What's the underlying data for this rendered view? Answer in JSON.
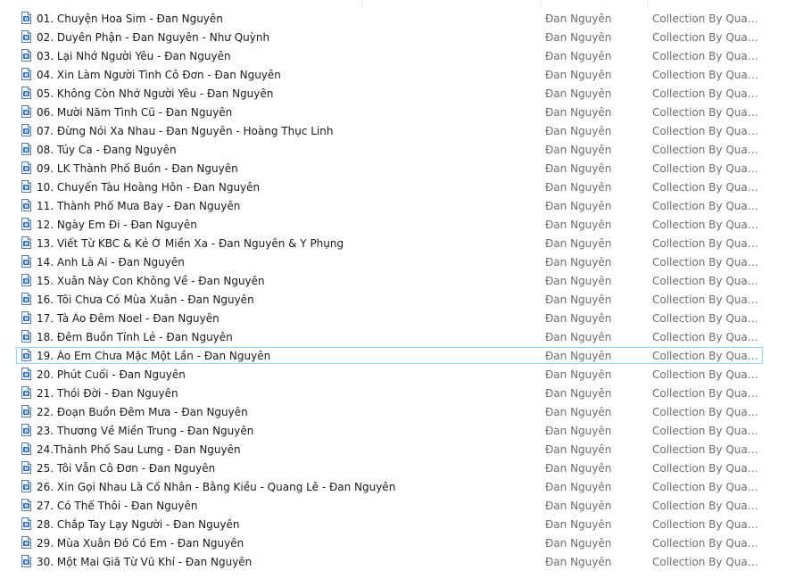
{
  "file_list": {
    "rows": [
      {
        "name": "01. Chuyện Hoa Sim - Đan Nguyên",
        "artist": "Đan Nguyên",
        "album": "Collection By Quang ..."
      },
      {
        "name": "02. Duyên Phận - Đan Nguyên - Như Quỳnh",
        "artist": "Đan Nguyên",
        "album": "Collection By Quang ..."
      },
      {
        "name": "03. Lại Nhớ Người Yêu - Đan Nguyên",
        "artist": "Đan Nguyên",
        "album": "Collection By Quang ..."
      },
      {
        "name": "04. Xin Làm Người Tình Cô Đơn - Đan Nguyên",
        "artist": "Đan Nguyên",
        "album": "Collection By Quang ..."
      },
      {
        "name": "05. Không Còn Nhớ Người Yêu - Đan Nguyên",
        "artist": "Đan Nguyên",
        "album": "Collection By Quang ..."
      },
      {
        "name": "06. Mười Năm Tình Cũ - Đan Nguyên",
        "artist": "Đan Nguyên",
        "album": "Collection By Quang ..."
      },
      {
        "name": "07. Đừng Nói Xa Nhau - Đan Nguyên - Hoàng Thục Linh",
        "artist": "Đan Nguyên",
        "album": "Collection By Quang ..."
      },
      {
        "name": "08. Túy Ca - Đang Nguyên",
        "artist": "Đan Nguyên",
        "album": "Collection By Quang ..."
      },
      {
        "name": "09. LK Thành Phố Buồn - Đan Nguyên",
        "artist": "Đan Nguyên",
        "album": "Collection By Quang ..."
      },
      {
        "name": "10. Chuyến Tàu Hoàng Hôn - Đan Nguyên",
        "artist": "Đan Nguyên",
        "album": "Collection By Quang ..."
      },
      {
        "name": "11. Thành Phố Mưa Bay - Đan Nguyên",
        "artist": "Đan Nguyên",
        "album": "Collection By Quang ..."
      },
      {
        "name": "12. Ngày Em Đi - Đan Nguyên",
        "artist": "Đan Nguyên",
        "album": "Collection By Quang ..."
      },
      {
        "name": "13. Viết Từ KBC &  Kẻ Ở Miền Xa - Đan Nguyên & Y Phụng",
        "artist": "Đan Nguyên",
        "album": "Collection By Quang ..."
      },
      {
        "name": "14. Anh Là Ai - Đan Nguyên",
        "artist": "Đan Nguyên",
        "album": "Collection By Quang ..."
      },
      {
        "name": "15. Xuân Này Con Không Về - Đan Nguyên",
        "artist": "Đan Nguyên",
        "album": "Collection By Quang ..."
      },
      {
        "name": "16. Tôi Chưa Có Mùa Xuân - Đan Nguyên",
        "artist": "Đan Nguyên",
        "album": "Collection By Quang ..."
      },
      {
        "name": "17. Tà Áo Đêm Noel - Đan Nguyên",
        "artist": "Đan Nguyên",
        "album": "Collection By Quang ..."
      },
      {
        "name": "18. Đêm Buồn Tỉnh Lẻ - Đan Nguyên",
        "artist": "Đan Nguyên",
        "album": "Collection By Quang ..."
      },
      {
        "name": "19. Áo Em Chưa Mặc Một Lần - Đan Nguyên",
        "artist": "Đan Nguyên",
        "album": "Collection By Quang ...",
        "selected": true
      },
      {
        "name": "20. Phút Cuối - Đan Nguyên",
        "artist": "Đan Nguyên",
        "album": "Collection By Quang ..."
      },
      {
        "name": "21. Thói Đời - Đan Nguyên",
        "artist": "Đan Nguyên",
        "album": "Collection By Quang ..."
      },
      {
        "name": "22. Đoạn Buồn Đêm Mưa - Đan Nguyên",
        "artist": "Đan Nguyên",
        "album": "Collection By Quang ..."
      },
      {
        "name": "23. Thương Về Miền Trung - Đan Nguyên",
        "artist": "Đan Nguyên",
        "album": "Collection By Quang ..."
      },
      {
        "name": "24.Thành Phố Sau Lưng - Đan Nguyên",
        "artist": "Đan Nguyên",
        "album": "Collection By Quang ..."
      },
      {
        "name": "25. Tôi Vẫn Cô Đơn - Đan Nguyên",
        "artist": "Đan Nguyên",
        "album": "Collection By Quang ..."
      },
      {
        "name": "26. Xin Gọi Nhau Là Cố Nhân - Bằng Kiều - Quang Lê - Đan Nguyên",
        "artist": "Đan Nguyên",
        "album": "Collection By Quang ..."
      },
      {
        "name": "27. Có Thế Thôi - Đan Nguyên",
        "artist": "Đan Nguyên",
        "album": "Collection By Quang ..."
      },
      {
        "name": "28. Chắp Tay Lạy Người - Đan Nguyên",
        "artist": "Đan Nguyên",
        "album": "Collection By Quang ..."
      },
      {
        "name": "29. Mùa Xuân Đó Có Em - Đan Nguyên",
        "artist": "Đan Nguyên",
        "album": "Collection By Quang ..."
      },
      {
        "name": "30. Một Mai Giã Từ Vũ Khí - Đan Nguyên",
        "artist": "Đan Nguyên",
        "album": "Collection By Quang ..."
      }
    ]
  },
  "icons": {
    "file": "audio-file-icon"
  },
  "colors": {
    "selection_border": "#99d1ff",
    "name_text": "#1a1a1a",
    "secondary_text": "#6d6d6d",
    "icon_accent": "#2e6db8"
  }
}
